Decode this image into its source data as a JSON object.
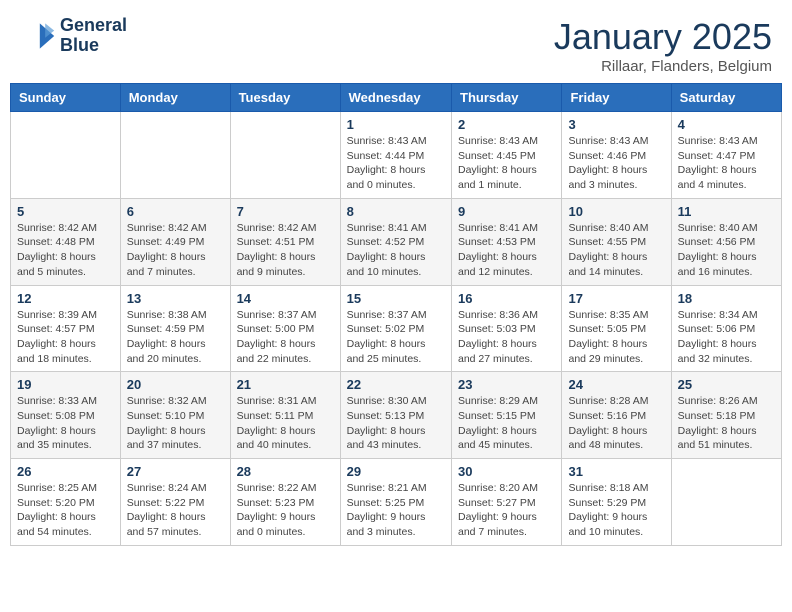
{
  "header": {
    "logo_line1": "General",
    "logo_line2": "Blue",
    "month_title": "January 2025",
    "location": "Rillaar, Flanders, Belgium"
  },
  "weekdays": [
    "Sunday",
    "Monday",
    "Tuesday",
    "Wednesday",
    "Thursday",
    "Friday",
    "Saturday"
  ],
  "weeks": [
    [
      {
        "day": "",
        "info": ""
      },
      {
        "day": "",
        "info": ""
      },
      {
        "day": "",
        "info": ""
      },
      {
        "day": "1",
        "info": "Sunrise: 8:43 AM\nSunset: 4:44 PM\nDaylight: 8 hours\nand 0 minutes."
      },
      {
        "day": "2",
        "info": "Sunrise: 8:43 AM\nSunset: 4:45 PM\nDaylight: 8 hours\nand 1 minute."
      },
      {
        "day": "3",
        "info": "Sunrise: 8:43 AM\nSunset: 4:46 PM\nDaylight: 8 hours\nand 3 minutes."
      },
      {
        "day": "4",
        "info": "Sunrise: 8:43 AM\nSunset: 4:47 PM\nDaylight: 8 hours\nand 4 minutes."
      }
    ],
    [
      {
        "day": "5",
        "info": "Sunrise: 8:42 AM\nSunset: 4:48 PM\nDaylight: 8 hours\nand 5 minutes."
      },
      {
        "day": "6",
        "info": "Sunrise: 8:42 AM\nSunset: 4:49 PM\nDaylight: 8 hours\nand 7 minutes."
      },
      {
        "day": "7",
        "info": "Sunrise: 8:42 AM\nSunset: 4:51 PM\nDaylight: 8 hours\nand 9 minutes."
      },
      {
        "day": "8",
        "info": "Sunrise: 8:41 AM\nSunset: 4:52 PM\nDaylight: 8 hours\nand 10 minutes."
      },
      {
        "day": "9",
        "info": "Sunrise: 8:41 AM\nSunset: 4:53 PM\nDaylight: 8 hours\nand 12 minutes."
      },
      {
        "day": "10",
        "info": "Sunrise: 8:40 AM\nSunset: 4:55 PM\nDaylight: 8 hours\nand 14 minutes."
      },
      {
        "day": "11",
        "info": "Sunrise: 8:40 AM\nSunset: 4:56 PM\nDaylight: 8 hours\nand 16 minutes."
      }
    ],
    [
      {
        "day": "12",
        "info": "Sunrise: 8:39 AM\nSunset: 4:57 PM\nDaylight: 8 hours\nand 18 minutes."
      },
      {
        "day": "13",
        "info": "Sunrise: 8:38 AM\nSunset: 4:59 PM\nDaylight: 8 hours\nand 20 minutes."
      },
      {
        "day": "14",
        "info": "Sunrise: 8:37 AM\nSunset: 5:00 PM\nDaylight: 8 hours\nand 22 minutes."
      },
      {
        "day": "15",
        "info": "Sunrise: 8:37 AM\nSunset: 5:02 PM\nDaylight: 8 hours\nand 25 minutes."
      },
      {
        "day": "16",
        "info": "Sunrise: 8:36 AM\nSunset: 5:03 PM\nDaylight: 8 hours\nand 27 minutes."
      },
      {
        "day": "17",
        "info": "Sunrise: 8:35 AM\nSunset: 5:05 PM\nDaylight: 8 hours\nand 29 minutes."
      },
      {
        "day": "18",
        "info": "Sunrise: 8:34 AM\nSunset: 5:06 PM\nDaylight: 8 hours\nand 32 minutes."
      }
    ],
    [
      {
        "day": "19",
        "info": "Sunrise: 8:33 AM\nSunset: 5:08 PM\nDaylight: 8 hours\nand 35 minutes."
      },
      {
        "day": "20",
        "info": "Sunrise: 8:32 AM\nSunset: 5:10 PM\nDaylight: 8 hours\nand 37 minutes."
      },
      {
        "day": "21",
        "info": "Sunrise: 8:31 AM\nSunset: 5:11 PM\nDaylight: 8 hours\nand 40 minutes."
      },
      {
        "day": "22",
        "info": "Sunrise: 8:30 AM\nSunset: 5:13 PM\nDaylight: 8 hours\nand 43 minutes."
      },
      {
        "day": "23",
        "info": "Sunrise: 8:29 AM\nSunset: 5:15 PM\nDaylight: 8 hours\nand 45 minutes."
      },
      {
        "day": "24",
        "info": "Sunrise: 8:28 AM\nSunset: 5:16 PM\nDaylight: 8 hours\nand 48 minutes."
      },
      {
        "day": "25",
        "info": "Sunrise: 8:26 AM\nSunset: 5:18 PM\nDaylight: 8 hours\nand 51 minutes."
      }
    ],
    [
      {
        "day": "26",
        "info": "Sunrise: 8:25 AM\nSunset: 5:20 PM\nDaylight: 8 hours\nand 54 minutes."
      },
      {
        "day": "27",
        "info": "Sunrise: 8:24 AM\nSunset: 5:22 PM\nDaylight: 8 hours\nand 57 minutes."
      },
      {
        "day": "28",
        "info": "Sunrise: 8:22 AM\nSunset: 5:23 PM\nDaylight: 9 hours\nand 0 minutes."
      },
      {
        "day": "29",
        "info": "Sunrise: 8:21 AM\nSunset: 5:25 PM\nDaylight: 9 hours\nand 3 minutes."
      },
      {
        "day": "30",
        "info": "Sunrise: 8:20 AM\nSunset: 5:27 PM\nDaylight: 9 hours\nand 7 minutes."
      },
      {
        "day": "31",
        "info": "Sunrise: 8:18 AM\nSunset: 5:29 PM\nDaylight: 9 hours\nand 10 minutes."
      },
      {
        "day": "",
        "info": ""
      }
    ]
  ]
}
